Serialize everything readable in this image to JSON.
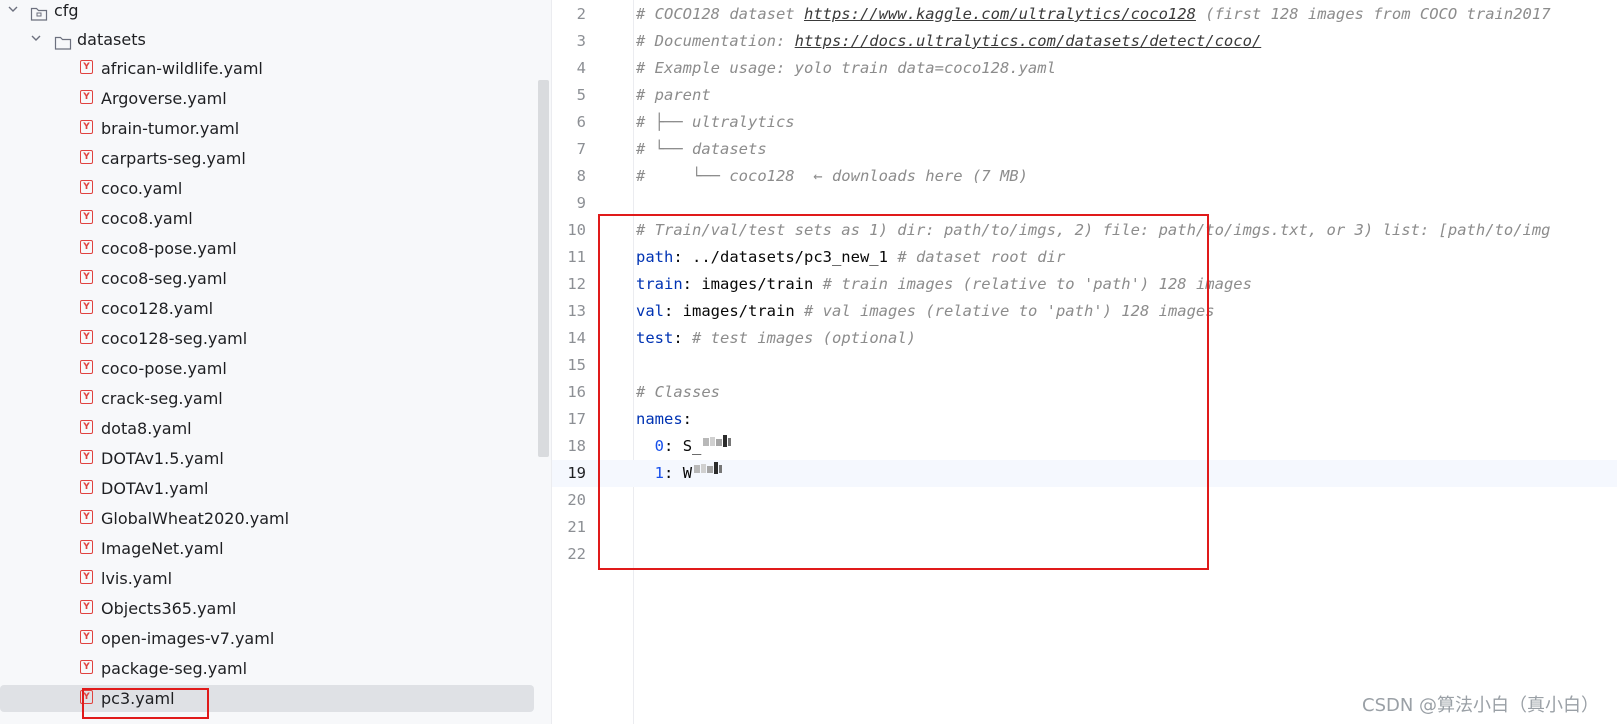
{
  "tree": {
    "root_folder": "cfg",
    "sub_folder": "datasets",
    "files": [
      "african-wildlife.yaml",
      "Argoverse.yaml",
      "brain-tumor.yaml",
      "carparts-seg.yaml",
      "coco.yaml",
      "coco8.yaml",
      "coco8-pose.yaml",
      "coco8-seg.yaml",
      "coco128.yaml",
      "coco128-seg.yaml",
      "coco-pose.yaml",
      "crack-seg.yaml",
      "dota8.yaml",
      "DOTAv1.5.yaml",
      "DOTAv1.yaml",
      "GlobalWheat2020.yaml",
      "ImageNet.yaml",
      "lvis.yaml",
      "Objects365.yaml",
      "open-images-v7.yaml",
      "package-seg.yaml",
      "pc3.yaml"
    ],
    "selected_file": "pc3.yaml",
    "yaml_icon_letter": "Y"
  },
  "editor": {
    "lines": [
      {
        "n": "2",
        "t": "# COCO128 dataset ",
        "link": "https://www.kaggle.com/ultralytics/coco128",
        "after": " (first 128 images from COCO train2017"
      },
      {
        "n": "3",
        "t": "# Documentation: ",
        "link": "https://docs.ultralytics.com/datasets/detect/coco/",
        "after": ""
      },
      {
        "n": "4",
        "t": "# Example usage: yolo train data=coco128.yaml"
      },
      {
        "n": "5",
        "t": "# parent"
      },
      {
        "n": "6",
        "t": "# ├── ultralytics"
      },
      {
        "n": "7",
        "t": "# └── datasets"
      },
      {
        "n": "8",
        "t": "#     └── coco128  ← downloads here (7 MB)"
      },
      {
        "n": "9",
        "t": ""
      },
      {
        "n": "10",
        "t": "# Train/val/test sets as 1) dir: path/to/imgs, 2) file: path/to/imgs.txt, or 3) list: [path/to/img"
      },
      {
        "n": "11",
        "k": "path",
        "v": " ../datasets/pc3_new_1 ",
        "c": "# dataset root dir"
      },
      {
        "n": "12",
        "k": "train",
        "v": " images/train ",
        "c": "# train images (relative to 'path') 128 images"
      },
      {
        "n": "13",
        "k": "val",
        "v": " images/train ",
        "c": "# val images (relative to 'path') 128 images"
      },
      {
        "n": "14",
        "k": "test",
        "v": " ",
        "c": "# test images (optional)"
      },
      {
        "n": "15",
        "t": ""
      },
      {
        "n": "16",
        "t": "# Classes"
      },
      {
        "n": "17",
        "k": "names",
        "v": "",
        "c": ""
      },
      {
        "n": "18",
        "idx": "0",
        "val": "S_"
      },
      {
        "n": "19",
        "idx": "1",
        "val": "W"
      },
      {
        "n": "20",
        "t": ""
      },
      {
        "n": "21",
        "t": ""
      },
      {
        "n": "22",
        "t": ""
      }
    ],
    "current_line": "19"
  },
  "watermark": "CSDN @算法小白（真小白）",
  "colors": {
    "highlight_box": "#e01a1a",
    "keyword": "#0033b3",
    "comment": "#8c8c8c"
  }
}
